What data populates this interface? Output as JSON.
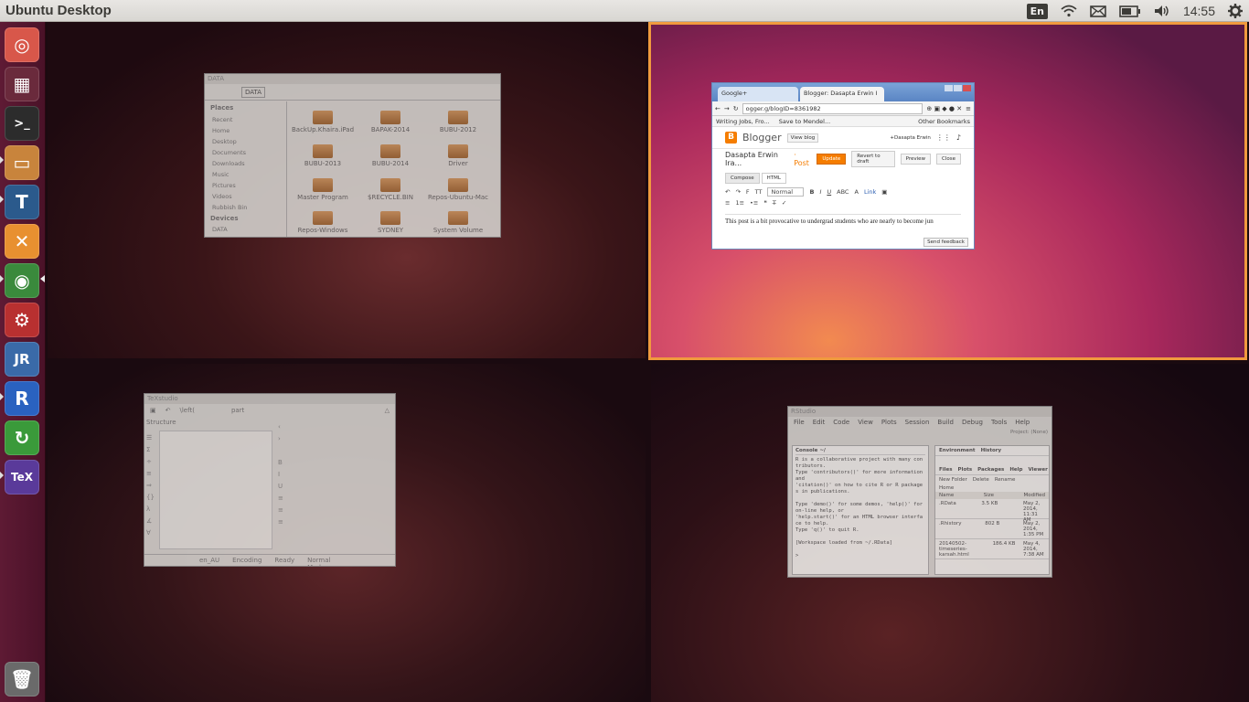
{
  "top_panel": {
    "title": "Ubuntu Desktop",
    "language": "En",
    "clock": "14:55",
    "icons": [
      "wifi-icon",
      "mail-icon",
      "battery-icon",
      "volume-icon",
      "settings-gear-icon"
    ]
  },
  "launcher": {
    "items": [
      {
        "name": "ubuntu-dash",
        "label": "◎",
        "color": "#d8574a"
      },
      {
        "name": "workspace-switcher",
        "label": "▦",
        "color": "#6a2a3c"
      },
      {
        "name": "terminal",
        "label": ">_",
        "color": "#2c2c2c"
      },
      {
        "name": "files",
        "label": "▭",
        "color": "#c8843c"
      },
      {
        "name": "texmaker",
        "label": "T",
        "color": "#2b5a8c"
      },
      {
        "name": "app-x",
        "label": "✕",
        "color": "#e89030"
      },
      {
        "name": "chromium",
        "label": "◉",
        "color": "#3a8a3c"
      },
      {
        "name": "system-tools",
        "label": "⚙",
        "color": "#b83030"
      },
      {
        "name": "jabref",
        "label": "JR",
        "color": "#3a6aa8"
      },
      {
        "name": "r-project",
        "label": "R",
        "color": "#2a62c0"
      },
      {
        "name": "update-manager",
        "label": "↻",
        "color": "#3a9a3a"
      },
      {
        "name": "texstudio",
        "label": "TeX",
        "color": "#5a3a9a"
      },
      {
        "name": "trash",
        "label": "🗑",
        "color": "#6a6a6a"
      }
    ]
  },
  "file_manager": {
    "title": "DATA",
    "location": "DATA",
    "places_header": "Places",
    "places": [
      "Recent",
      "Home",
      "Desktop",
      "Documents",
      "Downloads",
      "Music",
      "Pictures",
      "Videos",
      "Rubbish Bin"
    ],
    "devices_header": "Devices",
    "devices": [
      "DATA"
    ],
    "folders": [
      "BackUp.Khaira.iPad",
      "BAPAK-2014",
      "BUBU-2012",
      "BUBU-2013",
      "BUBU-2014",
      "Driver",
      "Master Program",
      "$RECYCLE.BIN",
      "Repos-Ubuntu-Mac",
      "Repos-Windows",
      "SYDNEY",
      "System Volume"
    ]
  },
  "chrome": {
    "tabs": [
      "Google+",
      "Blogger: Dasapta Erwin I"
    ],
    "url": "ogger.g/blogID=8361982",
    "bookmarks": [
      "Writing Jobs, Fro...",
      "Save to Mendel...",
      "Other Bookmarks"
    ],
    "blogger_brand": "Blogger",
    "view_blog": "View blog",
    "user": "+Dasapta Erwin",
    "blog_name": "Dasapta Erwin Ira...",
    "post_label": "· Post",
    "buttons": {
      "update": "Update",
      "revert": "Revert to draft",
      "preview": "Preview",
      "close": "Close"
    },
    "editor_tabs": [
      "Compose",
      "HTML"
    ],
    "format_normal": "Normal",
    "link": "Link",
    "editor_text": "This post is a bit provocative to undergrad students who are nearly to become jun",
    "send_feedback": "Send feedback"
  },
  "texstudio": {
    "title": "TeXstudio",
    "toolbar": [
      "\\left(",
      "part"
    ],
    "structure": "Structure",
    "status": [
      "en_AU",
      "Encoding",
      "Ready",
      "Normal Mode"
    ]
  },
  "rstudio": {
    "title": "RStudio",
    "menu": [
      "File",
      "Edit",
      "Code",
      "View",
      "Plots",
      "Session",
      "Build",
      "Debug",
      "Tools",
      "Help"
    ],
    "project": "Project: (None)",
    "console_label": "Console ~/",
    "console_lines": [
      "R is a collaborative project with many con",
      "tributors.",
      "Type 'contributors()' for more information",
      "and",
      "'citation()' on how to cite R or R package",
      "s in publications.",
      "",
      "Type 'demo()' for some demos, 'help()' for",
      "on-line help, or",
      "'help.start()' for an HTML browser interfa",
      "ce to help.",
      "Type 'q()' to quit R.",
      "",
      "[Workspace loaded from ~/.RData]",
      "",
      ">"
    ],
    "env_tabs": [
      "Environment",
      "History"
    ],
    "file_tabs": [
      "Files",
      "Plots",
      "Packages",
      "Help",
      "Viewer"
    ],
    "file_actions": [
      "New Folder",
      "Delete",
      "Rename"
    ],
    "home": "Home",
    "columns": [
      "Name",
      "Size",
      "Modified"
    ],
    "files": [
      {
        "name": ".RData",
        "size": "3.5 KB",
        "modified": "May 2, 2014, 11:31 AM"
      },
      {
        "name": ".Rhistory",
        "size": "802 B",
        "modified": "May 2, 2014, 1:35 PM"
      },
      {
        "name": "20140502-timeseries-karsah.html",
        "size": "186.4 KB",
        "modified": "May 4, 2014, 7:38 AM"
      }
    ]
  }
}
